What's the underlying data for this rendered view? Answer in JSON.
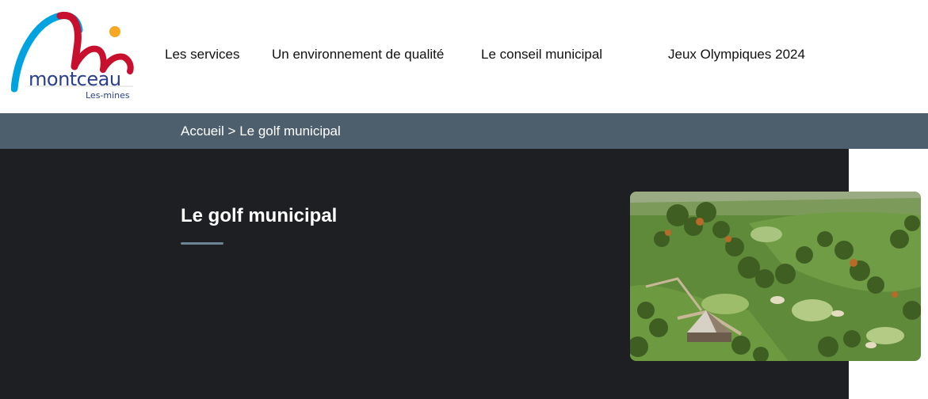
{
  "logo": {
    "wordmark": "montceau",
    "subline": "Les-mines"
  },
  "nav": {
    "items": [
      {
        "label": "Les services"
      },
      {
        "label": "Un environnement de qualité"
      },
      {
        "label": "Le conseil municipal"
      },
      {
        "label": "Jeux Olympiques 2024"
      }
    ]
  },
  "breadcrumb": {
    "home": "Accueil",
    "separator": ">",
    "current": "Le golf municipal"
  },
  "page": {
    "title": "Le golf municipal"
  },
  "colors": {
    "breadcrumb_bg": "#4d5f6c",
    "hero_bg": "#1e1f23",
    "logo_blue": "#2b3f8f",
    "logo_red": "#c8102e",
    "logo_cyan": "#00a3e0",
    "logo_orange": "#f7a823"
  }
}
